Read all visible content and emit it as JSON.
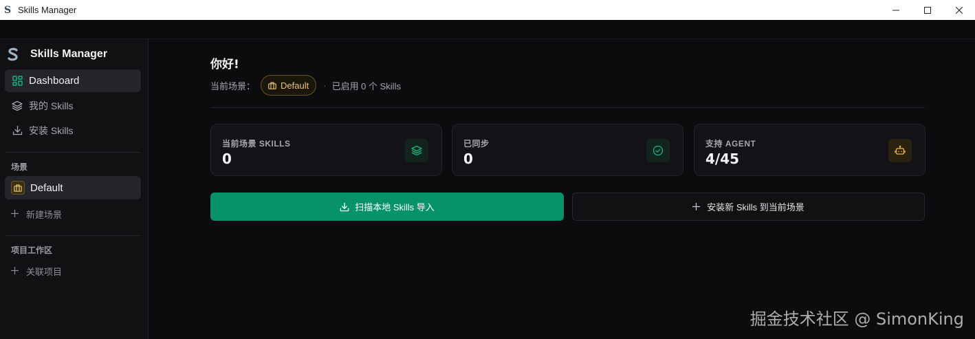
{
  "window": {
    "title": "Skills Manager",
    "app_glyph": "S",
    "controls": [
      "minimize-icon",
      "maximize-icon",
      "close-icon"
    ]
  },
  "sidebar": {
    "brand": "Skills Manager",
    "nav": [
      {
        "label": "Dashboard",
        "icon": "dashboard-grid-icon",
        "active": true
      },
      {
        "label": "我的 Skills",
        "icon": "layers-icon",
        "active": false
      },
      {
        "label": "安装 Skills",
        "icon": "download-icon",
        "active": false
      }
    ],
    "scenes_label": "场景",
    "scenes": [
      {
        "name": "Default",
        "icon": "briefcase-icon",
        "active": true
      }
    ],
    "new_scene": "新建场景",
    "workspace_label": "项目工作区",
    "link_project": "关联项目"
  },
  "main": {
    "greeting": "你好!",
    "current_scene_label": "当前场景：",
    "current_scene": "Default",
    "separator": "·",
    "enabled_text": "已启用 0 个 Skills",
    "cards": [
      {
        "label": "当前场景 SKILLS",
        "value": "0",
        "icon": "layers-icon",
        "color": "#10b981"
      },
      {
        "label": "已同步",
        "value": "0",
        "icon": "check-circle-icon",
        "color": "#10b981"
      },
      {
        "label": "支持 AGENT",
        "value": "4/45",
        "icon": "robot-icon",
        "color": "#f5b82e"
      }
    ],
    "primary_button": "扫描本地 Skills 导入",
    "secondary_button": "安装新 Skills 到当前场景"
  },
  "watermark": "掘金技术社区 @ SimonKing",
  "colors": {
    "accent_green": "#07936a",
    "accent_gold": "#e7c46a",
    "background": "#0c0c0e",
    "sidebar": "#111114"
  }
}
